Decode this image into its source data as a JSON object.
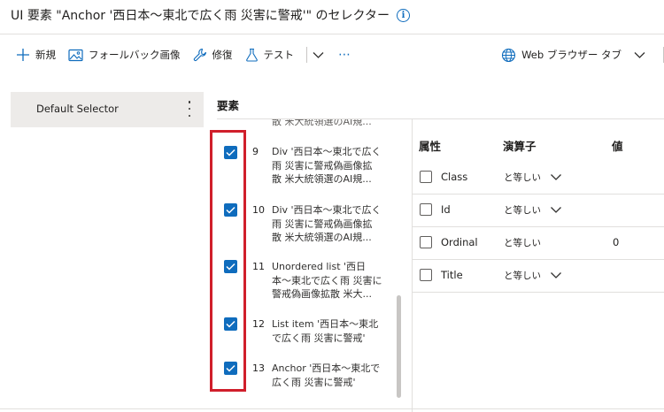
{
  "page": {
    "title": "UI 要素 \"Anchor '西日本～東北で広く雨 災害に警戒'\" のセレクター"
  },
  "toolbar": {
    "new_label": "新規",
    "fallback_label": "フォールバック画像",
    "repair_label": "修復",
    "test_label": "テスト",
    "more_label": "⋯",
    "browser_label": "Web ブラウザー タブ"
  },
  "selectors": {
    "items": [
      {
        "label": "Default Selector"
      }
    ]
  },
  "elements": {
    "header": "要素",
    "partial_top": "散 米大統領選のAI規...",
    "items": [
      {
        "num": "9",
        "text": "Div '西日本～東北で広く\n雨 災害に警戒偽画像拡\n散 米大統領選のAI規...",
        "checked": true
      },
      {
        "num": "10",
        "text": "Div '西日本～東北で広く\n雨 災害に警戒偽画像拡\n散 米大統領選のAI規...",
        "checked": true
      },
      {
        "num": "11",
        "text": "Unordered list '西日\n本～東北で広く雨 災害に\n警戒偽画像拡散 米大...",
        "checked": true
      },
      {
        "num": "12",
        "text": "List item '西日本～東北\nで広く雨 災害に警戒'",
        "checked": true
      },
      {
        "num": "13",
        "text": "Anchor '西日本～東北で\n広く雨 災害に警戒'",
        "checked": true
      }
    ]
  },
  "attributes": {
    "headers": {
      "name": "属性",
      "operator": "演算子",
      "value": "値"
    },
    "rows": [
      {
        "name": "Class",
        "operator": "と等しい",
        "value": "",
        "checked": false,
        "has_dropdown": true
      },
      {
        "name": "Id",
        "operator": "と等しい",
        "value": "",
        "checked": false,
        "has_dropdown": true
      },
      {
        "name": "Ordinal",
        "operator": "と等しい",
        "value": "0",
        "checked": false,
        "has_dropdown": false
      },
      {
        "name": "Title",
        "operator": "と等しい",
        "value": "",
        "checked": false,
        "has_dropdown": true
      }
    ]
  },
  "colors": {
    "accent": "#0f6cbd",
    "highlight_border": "#d01f2b",
    "selected_bg": "#edebe9"
  }
}
